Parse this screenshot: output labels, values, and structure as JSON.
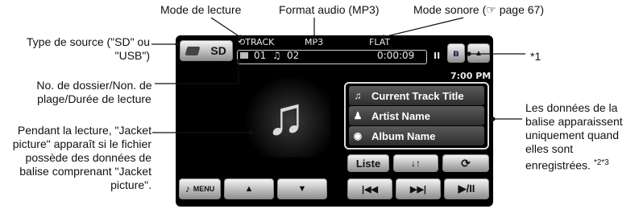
{
  "callouts": {
    "playback_mode": "Mode de lecture",
    "audio_format": "Format audio (MP3)",
    "sound_mode": "Mode sonore (☞ page 67)",
    "source_type": "Type de source (\"SD\" ou \"USB\")",
    "footnote_1": "*1",
    "folder_track_time": "No. de dossier/Non. de plage/Durée de lecture",
    "jacket_picture": "Pendant la lecture, \"Jacket picture\" apparaît si le fichier possède des données de balise comprenant \"Jacket picture\".",
    "tag_data": "Les données de la balise apparaissent uniquement quand elles sont enregistrées.",
    "tag_data_footnotes": "*2*3"
  },
  "screen": {
    "source_label": "SD",
    "repeat_mode": "TRACK",
    "format": "MP3",
    "sound": "FLAT",
    "folder_no": "01",
    "track_no": "02",
    "play_time": "0:00:09",
    "pause_indicator": "II",
    "clock": "7:00 PM",
    "tags": {
      "title": "Current Track Title",
      "artist": "Artist Name",
      "album": "Album Name"
    },
    "buttons": {
      "list": "Liste",
      "menu": "MENU",
      "play_pause": "▶/II"
    },
    "icons": [
      "sd-card-icon",
      "repeat-icon",
      "folder-icon",
      "music-note-icon",
      "bluetooth-icon",
      "eject-icon",
      "jacket-note-icon",
      "note-icon",
      "person-icon",
      "disc-icon",
      "shuffle-icon",
      "repeat-loop-icon",
      "menu-note-icon",
      "up-arrow-icon",
      "down-arrow-icon",
      "previous-icon",
      "next-icon"
    ]
  }
}
